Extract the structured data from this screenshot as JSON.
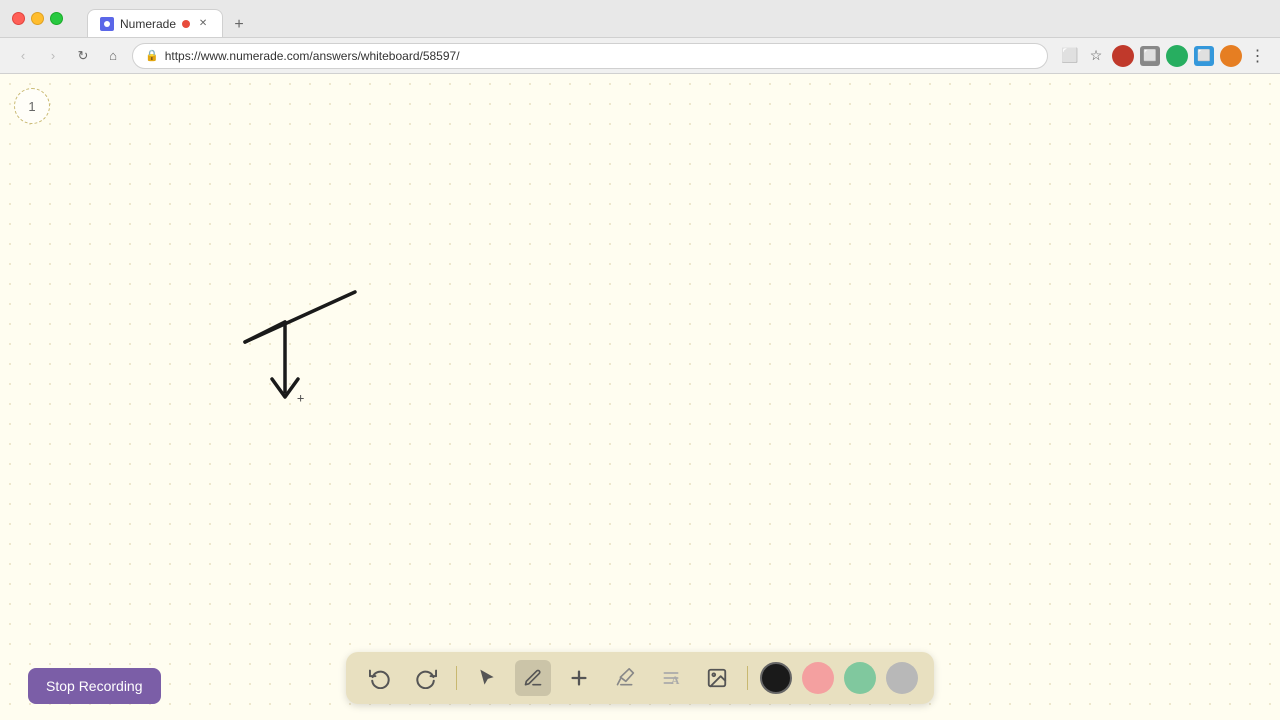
{
  "browser": {
    "tab_title": "Numerade",
    "tab_url": "https://www.numerade.com/answers/whiteboard/58597/",
    "new_tab_label": "+",
    "nav": {
      "back_label": "‹",
      "forward_label": "›",
      "refresh_label": "↻",
      "home_label": "⌂"
    }
  },
  "page": {
    "page_number": "1",
    "background_color": "#fffdf0",
    "dot_color": "#e8e0c0"
  },
  "toolbar": {
    "undo_label": "↺",
    "redo_label": "↻",
    "select_label": "↖",
    "pen_label": "✏",
    "add_label": "+",
    "eraser_label": "/",
    "text_label": "A",
    "image_label": "🖼",
    "colors": [
      {
        "name": "black",
        "value": "#1a1a1a"
      },
      {
        "name": "pink",
        "value": "#f4a0a0"
      },
      {
        "name": "green",
        "value": "#80c89e"
      },
      {
        "name": "gray",
        "value": "#b0b0b0"
      }
    ],
    "active_color": "black"
  },
  "stop_recording": {
    "label": "Stop Recording",
    "bg_color": "#7b5ea7"
  }
}
